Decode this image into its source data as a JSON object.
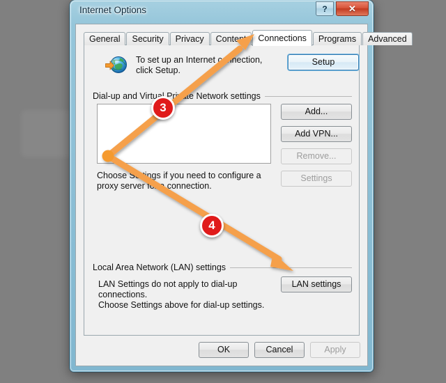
{
  "window": {
    "title": "Internet Options",
    "help_button_label": "?",
    "close_button_label": "✕",
    "frame_color": "#96c8dd"
  },
  "tabs": [
    {
      "label": "General",
      "active": false
    },
    {
      "label": "Security",
      "active": false
    },
    {
      "label": "Privacy",
      "active": false
    },
    {
      "label": "Content",
      "active": false
    },
    {
      "label": "Connections",
      "active": true
    },
    {
      "label": "Programs",
      "active": false
    },
    {
      "label": "Advanced",
      "active": false
    }
  ],
  "setup_section": {
    "icon": "globe-with-arrow-icon",
    "text": "To set up an Internet connection, click Setup.",
    "button_label": "Setup"
  },
  "dialup_section": {
    "caption": "Dial-up and Virtual Private Network settings",
    "list_items": [],
    "buttons": [
      {
        "label": "Add...",
        "disabled": false
      },
      {
        "label": "Add VPN...",
        "disabled": false
      },
      {
        "label": "Remove...",
        "disabled": true
      },
      {
        "label": "Settings",
        "disabled": true
      }
    ],
    "proxy_text": "Choose Settings if you need to configure a proxy server for a connection."
  },
  "lan_section": {
    "caption": "Local Area Network (LAN) settings",
    "text_line1": "LAN Settings do not apply to dial-up connections.",
    "text_line2": "Choose Settings above for dial-up settings.",
    "button_label": "LAN settings"
  },
  "dialog_buttons": [
    {
      "label": "OK",
      "disabled": false
    },
    {
      "label": "Cancel",
      "disabled": false
    },
    {
      "label": "Apply",
      "disabled": true
    }
  ],
  "annotations": {
    "accent_color": "#f5a04b",
    "badge_color": "#e01b1b",
    "steps": [
      {
        "number": "3",
        "target": "connections-tab"
      },
      {
        "number": "4",
        "target": "lan-settings-button"
      }
    ]
  }
}
